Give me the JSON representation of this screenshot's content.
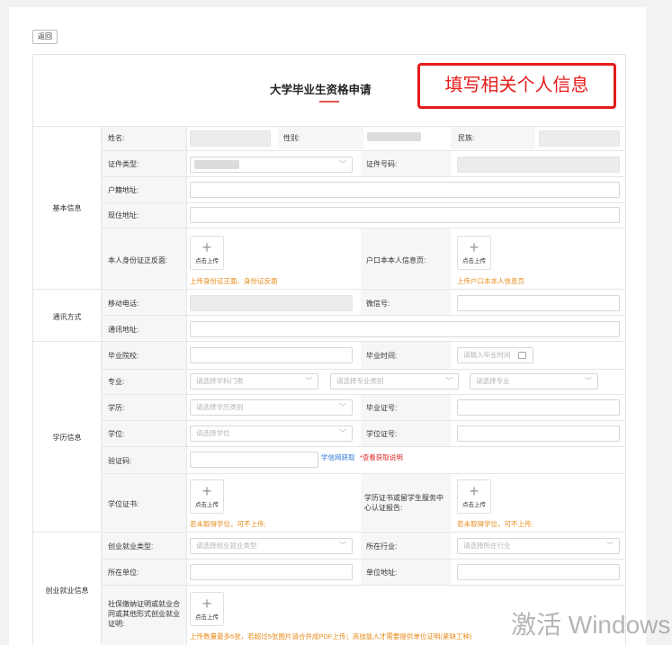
{
  "back_button": "返回",
  "form_title": "大学毕业生资格申请",
  "annotation": "填写相关个人信息",
  "sections": {
    "basic": "基本信息",
    "contact": "通讯方式",
    "education": "学历信息",
    "employment": "创业就业信息"
  },
  "labels": {
    "name": "姓名:",
    "gender": "性别:",
    "ethnicity": "民族:",
    "id_type": "证件类型:",
    "id_number": "证件号码:",
    "household_address": "户籍地址:",
    "current_address": "现住地址:",
    "id_card_photos": "本人身份证正反面:",
    "hukou_page": "户口本本人信息页:",
    "mobile": "移动电话:",
    "wechat": "微信号:",
    "mailing_address": "通讯地址:",
    "school": "毕业院校:",
    "grad_time": "毕业时间:",
    "major": "专业:",
    "education_level": "学历:",
    "diploma_no": "毕业证号:",
    "degree": "学位:",
    "degree_no": "学位证号:",
    "verify_code": "验证码:",
    "degree_cert": "学位证书:",
    "cert_report": "学历证书或留学生服务中心认证报告:",
    "employment_type": "创业就业类型:",
    "industry": "所在行业:",
    "employer": "所在单位:",
    "employer_address": "单位地址:",
    "social_security": "社保缴纳证明或就业合同或其他形式创业就业证明:"
  },
  "placeholders": {
    "grad_time": "请输入毕业时间",
    "major_category": "请选择学科门类",
    "major_class": "请选择专业类别",
    "major": "请选择专业",
    "education_level": "请选择学历类别",
    "degree": "请选择学位",
    "employment_type": "请选择创业就业类型",
    "industry": "请选择所在行业"
  },
  "upload_text": "点击上传",
  "hints": {
    "id_card": "上传身份证正面、身份证反面",
    "hukou": "上传户口本本人信息页",
    "degree_cert": "若未取得学位，可不上传;",
    "cert_report": "若未取得学位，可不上传;",
    "social_security": "上传数量最多5张，若超过5张图片请合并成PDF上传；高技能人才需要提供单位证明(紧缺工种)"
  },
  "verify": {
    "link": "学信网获取",
    "help": "*查看获取说明"
  },
  "watermark": {
    "line1": "激活 Windows"
  }
}
